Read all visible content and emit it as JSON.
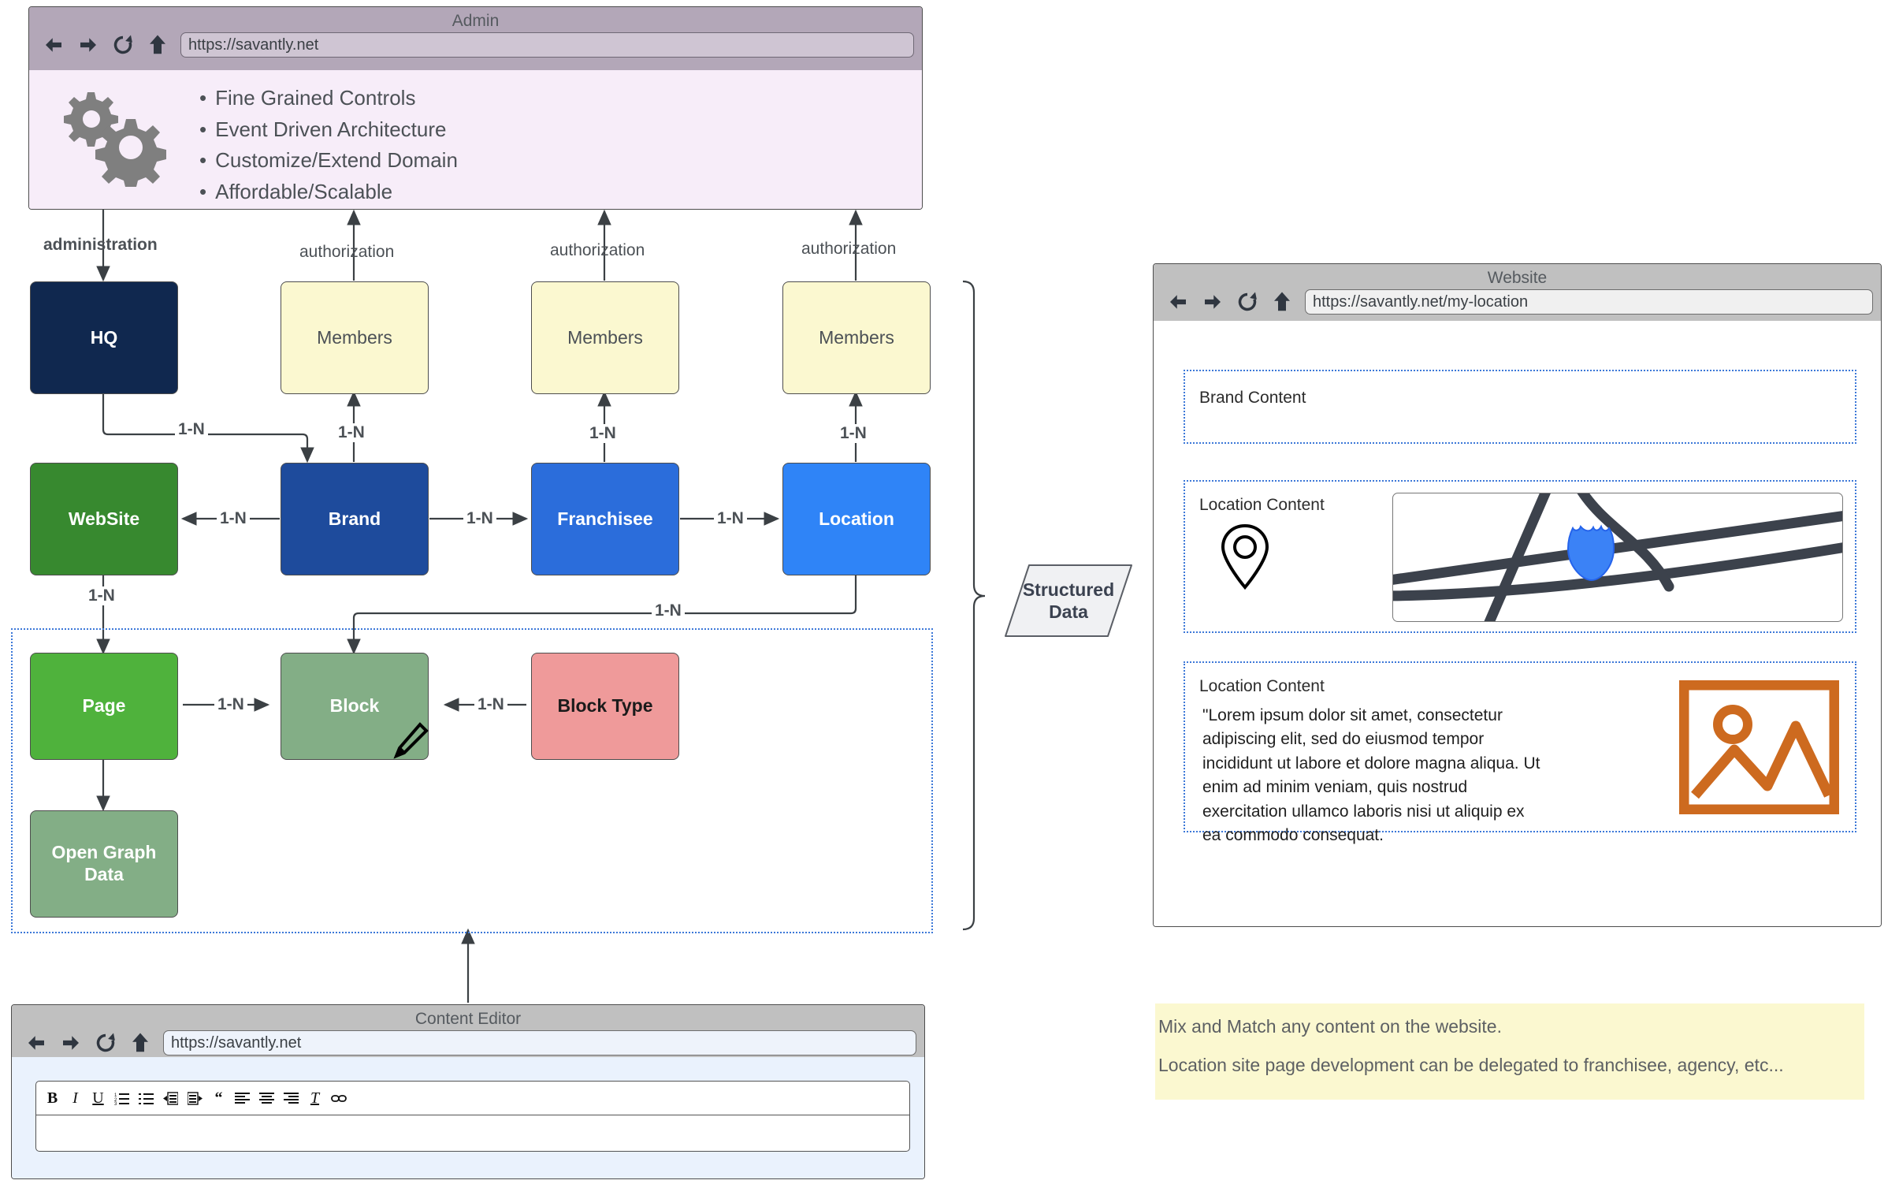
{
  "admin": {
    "title": "Admin",
    "url": "https://savantly.net",
    "gear_icon": "gears-icon",
    "features": [
      "Fine Grained Controls",
      "Event Driven Architecture",
      "Customize/Extend Domain",
      "Affordable/Scalable"
    ]
  },
  "website": {
    "title": "Website",
    "url": "https://savantly.net/my-location",
    "sections": [
      {
        "label": "Brand Content"
      },
      {
        "label": "Location Content"
      },
      {
        "label": "Location Content",
        "body": "\"Lorem ipsum dolor sit amet, consectetur adipiscing elit, sed do eiusmod tempor incididunt ut labore et dolore magna aliqua. Ut enim ad minim veniam, quis nostrud exercitation ullamco laboris nisi ut aliquip ex ea commodo consequat."
      }
    ]
  },
  "editor": {
    "title": "Content Editor",
    "url": "https://savantly.net",
    "toolbar": [
      "bold-icon",
      "italic-icon",
      "underline-icon",
      "ordered-list-icon",
      "unordered-list-icon",
      "outdent-icon",
      "indent-icon",
      "blockquote-icon",
      "align-left-icon",
      "align-center-icon",
      "align-right-icon",
      "clear-format-icon",
      "link-icon"
    ],
    "toolbar_glyphs": [
      "B",
      "I",
      "U",
      "☰",
      "☰",
      "☰",
      "☰",
      "“",
      "☰",
      "☰",
      "☰",
      "T",
      "⚭"
    ],
    "content": ""
  },
  "note": {
    "line1": "Mix and Match any content on the website.",
    "line2": "Location site page development can be delegated to franchisee, agency, etc..."
  },
  "structured_data": {
    "label_line1": "Structured",
    "label_line2": "Data"
  },
  "diagram": {
    "nodes": [
      {
        "id": "hq",
        "label": "HQ",
        "bg": "#10284f",
        "fg": "#ffffff"
      },
      {
        "id": "members1",
        "label": "Members",
        "bg": "#fbf8d0",
        "fg": "#4c5156"
      },
      {
        "id": "members2",
        "label": "Members",
        "bg": "#fbf8d0",
        "fg": "#4c5156"
      },
      {
        "id": "members3",
        "label": "Members",
        "bg": "#fbf8d0",
        "fg": "#4c5156"
      },
      {
        "id": "website",
        "label": "WebSite",
        "bg": "#37892f",
        "fg": "#ffffff"
      },
      {
        "id": "brand",
        "label": "Brand",
        "bg": "#1e4b9c",
        "fg": "#ffffff"
      },
      {
        "id": "franchisee",
        "label": "Franchisee",
        "bg": "#2b6ddb",
        "fg": "#ffffff"
      },
      {
        "id": "location",
        "label": "Location",
        "bg": "#2f84f7",
        "fg": "#ffffff"
      },
      {
        "id": "page",
        "label": "Page",
        "bg": "#4fb23c",
        "fg": "#ffffff"
      },
      {
        "id": "block",
        "label": "Block",
        "bg": "#83ae86",
        "fg": "#ffffff"
      },
      {
        "id": "blocktype",
        "label": "Block Type",
        "bg": "#ef9a9a",
        "fg": "#1b1b1b"
      },
      {
        "id": "opengraph",
        "label": "Open Graph\nData",
        "bg": "#83ae86",
        "fg": "#ffffff"
      }
    ],
    "edge_labels": {
      "administration": "administration",
      "authorization": "authorization",
      "one_to_many": "1-N"
    }
  }
}
